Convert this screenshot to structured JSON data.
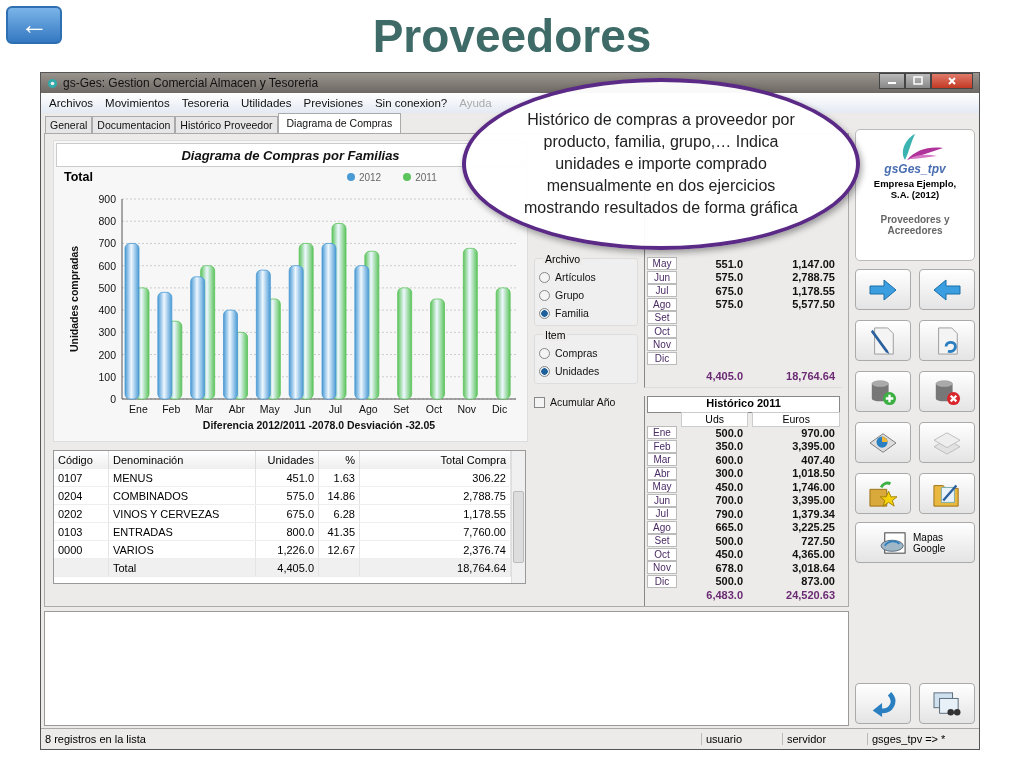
{
  "slide": {
    "back_button": "←",
    "title": "Proveedores"
  },
  "callout": {
    "text": "Histórico de compras a proveedor por producto, familia, grupo,… Indica unidades e importe comprado mensualmente en dos ejercicios mostrando resultados de forma gráfica"
  },
  "window": {
    "title": "gs-Ges: Gestion Comercial Almacen y Tesoreria",
    "menu": [
      {
        "label": "Archivos",
        "disabled": false
      },
      {
        "label": "Movimientos",
        "disabled": false
      },
      {
        "label": "Tesoreria",
        "disabled": false
      },
      {
        "label": "Utilidades",
        "disabled": false
      },
      {
        "label": "Previsiones",
        "disabled": false
      },
      {
        "label": "Sin conexion?",
        "disabled": false
      },
      {
        "label": "Ayuda",
        "disabled": true
      }
    ],
    "tabs": [
      {
        "label": "General",
        "selected": false
      },
      {
        "label": "Documentacion",
        "selected": false
      },
      {
        "label": "Histórico Proveedor",
        "selected": false
      },
      {
        "label": "Diagrama de Compras",
        "selected": true
      }
    ]
  },
  "chart_panel": {
    "header": "Diagrama de Compras por Familias",
    "chart_data": {
      "type": "bar",
      "title": "Total",
      "xlabel": "Diferencia 2012/2011  -2078.0  Desviación  -32.05",
      "ylabel": "Unidades compradas",
      "categories": [
        "Ene",
        "Feb",
        "Mar",
        "Abr",
        "May",
        "Jun",
        "Jul",
        "Ago",
        "Set",
        "Oct",
        "Nov",
        "Dic"
      ],
      "series": [
        {
          "name": "2012",
          "color": "#4a9ad4",
          "values": [
            700,
            480,
            550,
            400,
            580,
            600,
            700,
            600,
            0,
            0,
            0,
            0
          ]
        },
        {
          "name": "2011",
          "color": "#5cc45c",
          "values": [
            500,
            350,
            600,
            300,
            450,
            700,
            790,
            665,
            500,
            450,
            678,
            500
          ]
        }
      ],
      "grid": true,
      "ylim": [
        0,
        900
      ],
      "yticks": [
        0,
        100,
        200,
        300,
        400,
        500,
        600,
        700,
        800,
        900
      ]
    }
  },
  "table": {
    "columns": [
      "Código",
      "Denominación",
      "Unidades",
      "%",
      "Total Compra"
    ],
    "rows": [
      [
        "0107",
        "MENUS",
        "451.0",
        "1.63",
        "306.22"
      ],
      [
        "0204",
        "COMBINADOS",
        "575.0",
        "14.86",
        "2,788.75"
      ],
      [
        "0202",
        "VINOS Y CERVEZAS",
        "675.0",
        "6.28",
        "1,178.55"
      ],
      [
        "0103",
        "ENTRADAS",
        "800.0",
        "41.35",
        "7,760.00"
      ],
      [
        "0000",
        "VARIOS",
        "1,226.0",
        "12.67",
        "2,376.74"
      ]
    ],
    "total": {
      "label": "Total",
      "units": "4,405.0",
      "amount": "18,764.64"
    }
  },
  "archivo": {
    "title": "Archivo",
    "options": [
      {
        "label": "Artículos",
        "selected": false
      },
      {
        "label": "Grupo",
        "selected": false
      },
      {
        "label": "Familia",
        "selected": true
      }
    ]
  },
  "item": {
    "title": "Item",
    "options": [
      {
        "label": "Compras",
        "selected": false
      },
      {
        "label": "Unidades",
        "selected": true
      }
    ]
  },
  "acumular": {
    "label": "Acumular Año",
    "checked": false
  },
  "historico_2012": {
    "rows": [
      {
        "month": "May",
        "uds": "551.0",
        "euros": "1,147.00"
      },
      {
        "month": "Jun",
        "uds": "575.0",
        "euros": "2,788.75"
      },
      {
        "month": "Jul",
        "uds": "675.0",
        "euros": "1,178.55"
      },
      {
        "month": "Ago",
        "uds": "575.0",
        "euros": "5,577.50"
      },
      {
        "month": "Set"
      },
      {
        "month": "Oct"
      },
      {
        "month": "Nov"
      },
      {
        "month": "Dic"
      }
    ],
    "total_uds": "4,405.0",
    "total_euros": "18,764.64"
  },
  "historico_2011": {
    "title": "Histórico 2011",
    "columns": [
      "Uds",
      "Euros"
    ],
    "rows": [
      {
        "month": "Ene",
        "uds": "500.0",
        "euros": "970.00"
      },
      {
        "month": "Feb",
        "uds": "350.0",
        "euros": "3,395.00"
      },
      {
        "month": "Mar",
        "uds": "600.0",
        "euros": "407.40"
      },
      {
        "month": "Abr",
        "uds": "300.0",
        "euros": "1,018.50"
      },
      {
        "month": "May",
        "uds": "450.0",
        "euros": "1,746.00"
      },
      {
        "month": "Jun",
        "uds": "700.0",
        "euros": "3,395.00"
      },
      {
        "month": "Jul",
        "uds": "790.0",
        "euros": "1,379.34"
      },
      {
        "month": "Ago",
        "uds": "665.0",
        "euros": "3,225.25"
      },
      {
        "month": "Set",
        "uds": "500.0",
        "euros": "727.50"
      },
      {
        "month": "Oct",
        "uds": "450.0",
        "euros": "4,365.00"
      },
      {
        "month": "Nov",
        "uds": "678.0",
        "euros": "3,018.64"
      },
      {
        "month": "Dic",
        "uds": "500.0",
        "euros": "873.00"
      }
    ],
    "total_uds": "6,483.0",
    "total_euros": "24,520.63"
  },
  "sidebar": {
    "logo": "gsGes_tpv",
    "company": "Empresa Ejemplo, S.A. (2012)",
    "section": "Proveedores y Acreedores",
    "maps_button": "Mapas Google"
  },
  "status_bar": [
    "8 registros en la lista",
    "usuario",
    "servidor",
    "gsges_tpv => *"
  ]
}
